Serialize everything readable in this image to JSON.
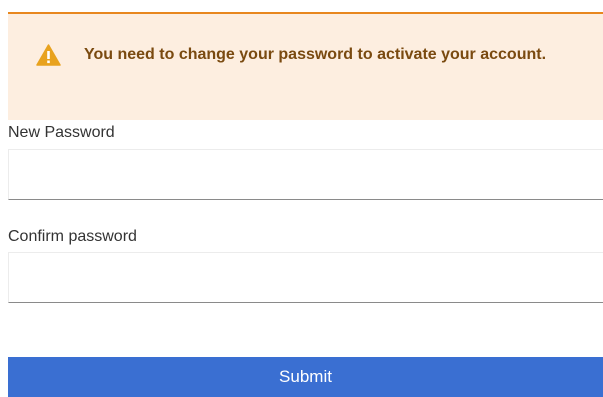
{
  "alert": {
    "message": "You need to change your password to activate your account.",
    "icon": "warning-icon",
    "color": "#e8871e",
    "background": "#fdeee0"
  },
  "form": {
    "new_password_label": "New Password",
    "new_password_value": "",
    "confirm_password_label": "Confirm password",
    "confirm_password_value": "",
    "submit_label": "Submit",
    "submit_color": "#3a6fd2"
  }
}
